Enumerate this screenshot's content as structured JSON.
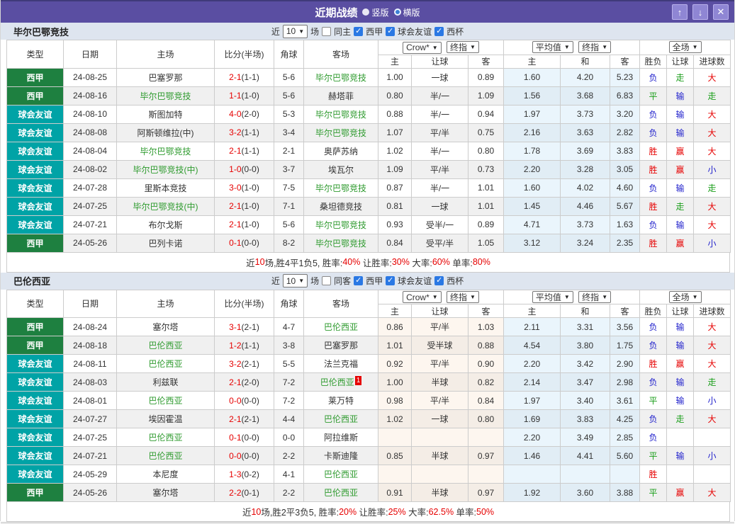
{
  "titlebar": {
    "title": "近期战绩",
    "vertical_label": "竖版",
    "horizontal_label": "横版",
    "selected_layout": "竖版",
    "up_icon": "↑",
    "down_icon": "↓",
    "close_icon": "✕",
    "bar_color": "#5a4ea2",
    "button_color": "#8f86d4"
  },
  "colors": {
    "league_liga": "#1e8040",
    "league_friendly": "#00a3a6",
    "focus_team": "#2f9b2f",
    "win_red": "#e60000",
    "lose_blue": "#2121cc",
    "draw_green": "#1a9e1a",
    "avg_col_bg": "#eaf5fc"
  },
  "sections": [
    {
      "team": "毕尔巴鄂竞技",
      "crow_tint": false,
      "filter": {
        "near_label": "近",
        "count": "10",
        "games_label": "场",
        "same_label": "同主",
        "same_checked": false,
        "leagues": [
          {
            "label": "西甲",
            "checked": true
          },
          {
            "label": "球会友谊",
            "checked": true
          },
          {
            "label": "西杯",
            "checked": true
          }
        ]
      },
      "header": {
        "base": [
          "类型",
          "日期",
          "主场",
          "比分(半场)",
          "角球",
          "客场"
        ],
        "crow_select": "Crow*",
        "crow_time_select": "终指",
        "crow_cols": [
          "主",
          "让球",
          "客"
        ],
        "avg_select": "平均值",
        "avg_time_select": "终指",
        "avg_cols": [
          "主",
          "和",
          "客"
        ],
        "full_select": "全场",
        "full_cols": [
          "胜负",
          "让球",
          "进球数"
        ]
      },
      "rows": [
        {
          "type": "西甲",
          "type_color": "green",
          "date": "24-08-25",
          "home": "巴塞罗那",
          "home_hl": false,
          "score": "2-1",
          "half": "(1-1)",
          "corner": "5-6",
          "away": "毕尔巴鄂竞技",
          "away_hl": true,
          "o1": "1.00",
          "hc": "一球",
          "o2": "0.89",
          "a1": "1.60",
          "a2": "4.20",
          "a3": "5.23",
          "r1": {
            "t": "负",
            "c": "blue"
          },
          "r2": {
            "t": "走",
            "c": "green"
          },
          "r3": {
            "t": "大",
            "c": "red"
          }
        },
        {
          "type": "西甲",
          "type_color": "green",
          "date": "24-08-16",
          "home": "毕尔巴鄂竞技",
          "home_hl": true,
          "score": "1-1",
          "half": "(1-0)",
          "corner": "5-6",
          "away": "赫塔菲",
          "away_hl": false,
          "o1": "0.80",
          "hc": "半/一",
          "o2": "1.09",
          "a1": "1.56",
          "a2": "3.68",
          "a3": "6.83",
          "r1": {
            "t": "平",
            "c": "green"
          },
          "r2": {
            "t": "输",
            "c": "blue"
          },
          "r3": {
            "t": "走",
            "c": "green"
          }
        },
        {
          "type": "球会友谊",
          "type_color": "teal",
          "date": "24-08-10",
          "home": "斯图加特",
          "home_hl": false,
          "score": "4-0",
          "half": "(2-0)",
          "corner": "5-3",
          "away": "毕尔巴鄂竞技",
          "away_hl": true,
          "o1": "0.88",
          "hc": "半/一",
          "o2": "0.94",
          "a1": "1.97",
          "a2": "3.73",
          "a3": "3.20",
          "r1": {
            "t": "负",
            "c": "blue"
          },
          "r2": {
            "t": "输",
            "c": "blue"
          },
          "r3": {
            "t": "大",
            "c": "red"
          }
        },
        {
          "type": "球会友谊",
          "type_color": "teal",
          "date": "24-08-08",
          "home": "阿斯顿维拉(中)",
          "home_hl": false,
          "score": "3-2",
          "half": "(1-1)",
          "corner": "3-4",
          "away": "毕尔巴鄂竞技",
          "away_hl": true,
          "o1": "1.07",
          "hc": "平/半",
          "o2": "0.75",
          "a1": "2.16",
          "a2": "3.63",
          "a3": "2.82",
          "r1": {
            "t": "负",
            "c": "blue"
          },
          "r2": {
            "t": "输",
            "c": "blue"
          },
          "r3": {
            "t": "大",
            "c": "red"
          }
        },
        {
          "type": "球会友谊",
          "type_color": "teal",
          "date": "24-08-04",
          "home": "毕尔巴鄂竞技",
          "home_hl": true,
          "score": "2-1",
          "half": "(1-1)",
          "corner": "2-1",
          "away": "奥萨苏纳",
          "away_hl": false,
          "o1": "1.02",
          "hc": "半/一",
          "o2": "0.80",
          "a1": "1.78",
          "a2": "3.69",
          "a3": "3.83",
          "r1": {
            "t": "胜",
            "c": "red"
          },
          "r2": {
            "t": "赢",
            "c": "red"
          },
          "r3": {
            "t": "大",
            "c": "red"
          }
        },
        {
          "type": "球会友谊",
          "type_color": "teal",
          "date": "24-08-02",
          "home": "毕尔巴鄂竞技(中)",
          "home_hl": true,
          "score": "1-0",
          "half": "(0-0)",
          "corner": "3-7",
          "away": "埃瓦尔",
          "away_hl": false,
          "o1": "1.09",
          "hc": "平/半",
          "o2": "0.73",
          "a1": "2.20",
          "a2": "3.28",
          "a3": "3.05",
          "r1": {
            "t": "胜",
            "c": "red"
          },
          "r2": {
            "t": "赢",
            "c": "red"
          },
          "r3": {
            "t": "小",
            "c": "blue"
          }
        },
        {
          "type": "球会友谊",
          "type_color": "teal",
          "date": "24-07-28",
          "home": "里斯本竞技",
          "home_hl": false,
          "score": "3-0",
          "half": "(1-0)",
          "corner": "7-5",
          "away": "毕尔巴鄂竞技",
          "away_hl": true,
          "o1": "0.87",
          "hc": "半/一",
          "o2": "1.01",
          "a1": "1.60",
          "a2": "4.02",
          "a3": "4.60",
          "r1": {
            "t": "负",
            "c": "blue"
          },
          "r2": {
            "t": "输",
            "c": "blue"
          },
          "r3": {
            "t": "走",
            "c": "green"
          }
        },
        {
          "type": "球会友谊",
          "type_color": "teal",
          "date": "24-07-25",
          "home": "毕尔巴鄂竞技(中)",
          "home_hl": true,
          "score": "2-1",
          "half": "(1-0)",
          "corner": "7-1",
          "away": "桑坦德竞技",
          "away_hl": false,
          "o1": "0.81",
          "hc": "一球",
          "o2": "1.01",
          "a1": "1.45",
          "a2": "4.46",
          "a3": "5.67",
          "r1": {
            "t": "胜",
            "c": "red"
          },
          "r2": {
            "t": "走",
            "c": "green"
          },
          "r3": {
            "t": "大",
            "c": "red"
          }
        },
        {
          "type": "球会友谊",
          "type_color": "teal",
          "date": "24-07-21",
          "home": "布尔戈斯",
          "home_hl": false,
          "score": "2-1",
          "half": "(1-0)",
          "corner": "5-6",
          "away": "毕尔巴鄂竞技",
          "away_hl": true,
          "o1": "0.93",
          "hc": "受半/一",
          "o2": "0.89",
          "a1": "4.71",
          "a2": "3.73",
          "a3": "1.63",
          "r1": {
            "t": "负",
            "c": "blue"
          },
          "r2": {
            "t": "输",
            "c": "blue"
          },
          "r3": {
            "t": "大",
            "c": "red"
          }
        },
        {
          "type": "西甲",
          "type_color": "green",
          "date": "24-05-26",
          "home": "巴列卡诺",
          "home_hl": false,
          "score": "0-1",
          "half": "(0-0)",
          "corner": "8-2",
          "away": "毕尔巴鄂竞技",
          "away_hl": true,
          "o1": "0.84",
          "hc": "受平/半",
          "o2": "1.05",
          "a1": "3.12",
          "a2": "3.24",
          "a3": "2.35",
          "r1": {
            "t": "胜",
            "c": "red"
          },
          "r2": {
            "t": "赢",
            "c": "red"
          },
          "r3": {
            "t": "小",
            "c": "blue"
          }
        }
      ],
      "summary": {
        "near": "近",
        "count": "10",
        "record": "场,胜4平1负5, 胜率:",
        "win_rate": "40%",
        "l2": " 让胜率:",
        "handicap_rate": "30%",
        "l3": " 大率:",
        "over_rate": "60%",
        "l4": " 单率:",
        "odd_rate": "80%"
      }
    },
    {
      "team": "巴伦西亚",
      "crow_tint": true,
      "filter": {
        "near_label": "近",
        "count": "10",
        "games_label": "场",
        "same_label": "同客",
        "same_checked": false,
        "leagues": [
          {
            "label": "西甲",
            "checked": true
          },
          {
            "label": "球会友谊",
            "checked": true
          },
          {
            "label": "西杯",
            "checked": true
          }
        ]
      },
      "header": {
        "base": [
          "类型",
          "日期",
          "主场",
          "比分(半场)",
          "角球",
          "客场"
        ],
        "crow_select": "Crow*",
        "crow_time_select": "终指",
        "crow_cols": [
          "主",
          "让球",
          "客"
        ],
        "avg_select": "平均值",
        "avg_time_select": "终指",
        "avg_cols": [
          "主",
          "和",
          "客"
        ],
        "full_select": "全场",
        "full_cols": [
          "胜负",
          "让球",
          "进球数"
        ]
      },
      "rows": [
        {
          "type": "西甲",
          "type_color": "green",
          "date": "24-08-24",
          "home": "塞尔塔",
          "home_hl": false,
          "score": "3-1",
          "half": "(2-1)",
          "corner": "4-7",
          "away": "巴伦西亚",
          "away_hl": true,
          "o1": "0.86",
          "hc": "平/半",
          "o2": "1.03",
          "a1": "2.11",
          "a2": "3.31",
          "a3": "3.56",
          "r1": {
            "t": "负",
            "c": "blue"
          },
          "r2": {
            "t": "输",
            "c": "blue"
          },
          "r3": {
            "t": "大",
            "c": "red"
          }
        },
        {
          "type": "西甲",
          "type_color": "green",
          "date": "24-08-18",
          "home": "巴伦西亚",
          "home_hl": true,
          "score": "1-2",
          "half": "(1-1)",
          "corner": "3-8",
          "away": "巴塞罗那",
          "away_hl": false,
          "o1": "1.01",
          "hc": "受半球",
          "o2": "0.88",
          "a1": "4.54",
          "a2": "3.80",
          "a3": "1.75",
          "r1": {
            "t": "负",
            "c": "blue"
          },
          "r2": {
            "t": "输",
            "c": "blue"
          },
          "r3": {
            "t": "大",
            "c": "red"
          }
        },
        {
          "type": "球会友谊",
          "type_color": "teal",
          "date": "24-08-11",
          "home": "巴伦西亚",
          "home_hl": true,
          "score": "3-2",
          "half": "(2-1)",
          "corner": "5-5",
          "away": "法兰克福",
          "away_hl": false,
          "o1": "0.92",
          "hc": "平/半",
          "o2": "0.90",
          "a1": "2.20",
          "a2": "3.42",
          "a3": "2.90",
          "r1": {
            "t": "胜",
            "c": "red"
          },
          "r2": {
            "t": "赢",
            "c": "red"
          },
          "r3": {
            "t": "大",
            "c": "red"
          }
        },
        {
          "type": "球会友谊",
          "type_color": "teal",
          "date": "24-08-03",
          "home": "利兹联",
          "home_hl": false,
          "score": "2-1",
          "half": "(2-0)",
          "corner": "7-2",
          "away": "巴伦西亚",
          "away_hl": true,
          "away_badge": "1",
          "o1": "1.00",
          "hc": "半球",
          "o2": "0.82",
          "a1": "2.14",
          "a2": "3.47",
          "a3": "2.98",
          "r1": {
            "t": "负",
            "c": "blue"
          },
          "r2": {
            "t": "输",
            "c": "blue"
          },
          "r3": {
            "t": "走",
            "c": "green"
          }
        },
        {
          "type": "球会友谊",
          "type_color": "teal",
          "date": "24-08-01",
          "home": "巴伦西亚",
          "home_hl": true,
          "score": "0-0",
          "half": "(0-0)",
          "corner": "7-2",
          "away": "莱万特",
          "away_hl": false,
          "o1": "0.98",
          "hc": "平/半",
          "o2": "0.84",
          "a1": "1.97",
          "a2": "3.40",
          "a3": "3.61",
          "r1": {
            "t": "平",
            "c": "green"
          },
          "r2": {
            "t": "输",
            "c": "blue"
          },
          "r3": {
            "t": "小",
            "c": "blue"
          }
        },
        {
          "type": "球会友谊",
          "type_color": "teal",
          "date": "24-07-27",
          "home": "埃因霍温",
          "home_hl": false,
          "score": "2-1",
          "half": "(2-1)",
          "corner": "4-4",
          "away": "巴伦西亚",
          "away_hl": true,
          "o1": "1.02",
          "hc": "一球",
          "o2": "0.80",
          "a1": "1.69",
          "a2": "3.83",
          "a3": "4.25",
          "r1": {
            "t": "负",
            "c": "blue"
          },
          "r2": {
            "t": "走",
            "c": "green"
          },
          "r3": {
            "t": "大",
            "c": "red"
          }
        },
        {
          "type": "球会友谊",
          "type_color": "teal",
          "date": "24-07-25",
          "home": "巴伦西亚",
          "home_hl": true,
          "score": "0-1",
          "half": "(0-0)",
          "corner": "0-0",
          "away": "阿拉维斯",
          "away_hl": false,
          "o1": "",
          "hc": "",
          "o2": "",
          "a1": "2.20",
          "a2": "3.49",
          "a3": "2.85",
          "r1": {
            "t": "负",
            "c": "blue"
          },
          "r2": {
            "t": "",
            "c": "none"
          },
          "r3": {
            "t": "",
            "c": "none"
          }
        },
        {
          "type": "球会友谊",
          "type_color": "teal",
          "date": "24-07-21",
          "home": "巴伦西亚",
          "home_hl": true,
          "score": "0-0",
          "half": "(0-0)",
          "corner": "2-2",
          "away": "卡斯迪隆",
          "away_hl": false,
          "o1": "0.85",
          "hc": "半球",
          "o2": "0.97",
          "a1": "1.46",
          "a2": "4.41",
          "a3": "5.60",
          "r1": {
            "t": "平",
            "c": "green"
          },
          "r2": {
            "t": "输",
            "c": "blue"
          },
          "r3": {
            "t": "小",
            "c": "blue"
          }
        },
        {
          "type": "球会友谊",
          "type_color": "teal",
          "date": "24-05-29",
          "home": "本尼度",
          "home_hl": false,
          "score": "1-3",
          "half": "(0-2)",
          "corner": "4-1",
          "away": "巴伦西亚",
          "away_hl": true,
          "o1": "",
          "hc": "",
          "o2": "",
          "a1": "",
          "a2": "",
          "a3": "",
          "r1": {
            "t": "胜",
            "c": "red"
          },
          "r2": {
            "t": "",
            "c": "none"
          },
          "r3": {
            "t": "",
            "c": "none"
          }
        },
        {
          "type": "西甲",
          "type_color": "green",
          "date": "24-05-26",
          "home": "塞尔塔",
          "home_hl": false,
          "score": "2-2",
          "half": "(0-1)",
          "corner": "2-2",
          "away": "巴伦西亚",
          "away_hl": true,
          "o1": "0.91",
          "hc": "半球",
          "o2": "0.97",
          "a1": "1.92",
          "a2": "3.60",
          "a3": "3.88",
          "r1": {
            "t": "平",
            "c": "green"
          },
          "r2": {
            "t": "赢",
            "c": "red"
          },
          "r3": {
            "t": "大",
            "c": "red"
          }
        }
      ],
      "summary": {
        "near": "近",
        "count": "10",
        "record": "场,胜2平3负5, 胜率:",
        "win_rate": "20%",
        "l2": " 让胜率:",
        "handicap_rate": "25%",
        "l3": " 大率:",
        "over_rate": "62.5%",
        "l4": " 单率:",
        "odd_rate": "50%"
      }
    }
  ]
}
